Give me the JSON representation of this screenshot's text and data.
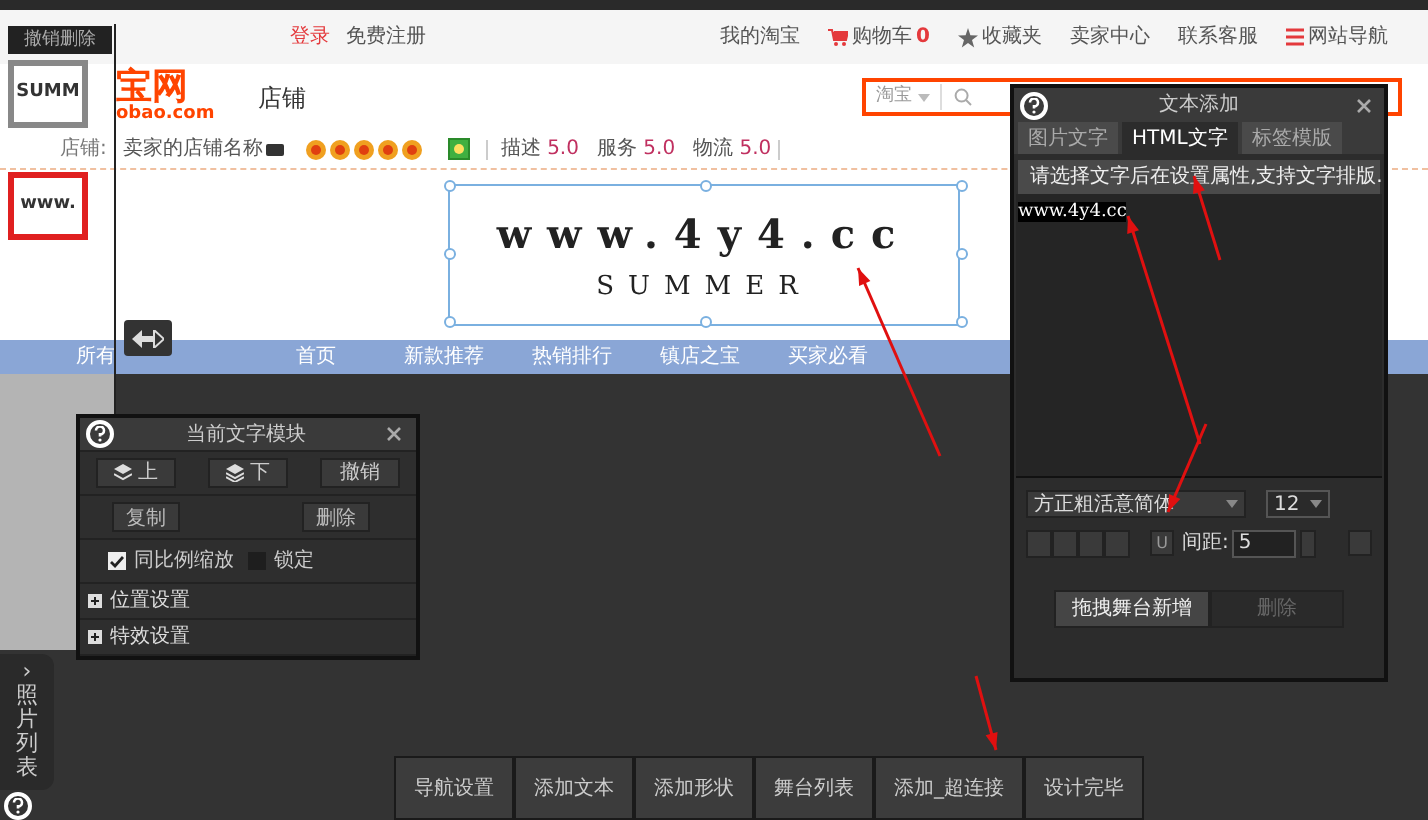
{
  "top_links": {
    "login": "登录",
    "register": "免费注册",
    "right": [
      {
        "label": "我的淘宝",
        "kind": "plain"
      },
      {
        "label": "购物车",
        "kind": "cart",
        "count": "0"
      },
      {
        "label": "收藏夹",
        "kind": "star"
      },
      {
        "label": "卖家中心",
        "kind": "plain"
      },
      {
        "label": "联系客服",
        "kind": "plain"
      },
      {
        "label": "网站导航",
        "kind": "menu"
      }
    ]
  },
  "logo": {
    "main": "宝网",
    "sub": "obao.com"
  },
  "shop_label": "店铺",
  "search": {
    "scope": "淘宝"
  },
  "shop_info": {
    "label": "店铺:",
    "name": "卖家的店铺名称",
    "ratings": [
      {
        "label": "描述",
        "value": "5.0"
      },
      {
        "label": "服务",
        "value": "5.0"
      },
      {
        "label": "物流",
        "value": "5.0"
      }
    ]
  },
  "canvas": {
    "title": "www.4y4.cc",
    "subtitle": "SUMMER"
  },
  "nav": [
    "所有",
    "首页",
    "新款推荐",
    "热销排行",
    "镇店之宝",
    "买家必看"
  ],
  "left_panel": {
    "undo": "撤销删除",
    "thumbnails": [
      {
        "label": "SUMM",
        "selected": false
      },
      {
        "label": "www.",
        "selected": true
      }
    ],
    "photo_tab": "照片列表",
    "expand": "›"
  },
  "module_panel": {
    "title": "当前文字模块",
    "buttons_row1": [
      {
        "label": "上",
        "kind": "up"
      },
      {
        "label": "下",
        "kind": "down"
      },
      {
        "label": "撤销",
        "kind": "plain"
      }
    ],
    "buttons_row2": [
      "复制",
      "删除"
    ],
    "checks": [
      {
        "label": "同比例缩放",
        "checked": true
      },
      {
        "label": "锁定",
        "checked": false
      }
    ],
    "sections": [
      {
        "label": "位置设置",
        "expanded": false
      },
      {
        "label": "特效设置",
        "expanded": false
      }
    ]
  },
  "text_panel": {
    "title": "文本添加",
    "tabs": [
      {
        "label": "图片文字",
        "selected": false
      },
      {
        "label": "HTML文字",
        "selected": true
      },
      {
        "label": "标签模版",
        "selected": false
      }
    ],
    "hint": "请选择文字后在设置属性,支持文字排版.",
    "content": "www.4y4.cc",
    "font": "方正粗活意简体",
    "size": "12",
    "underline": "U",
    "spacing_label": "间距:",
    "spacing": "5",
    "buttons": [
      {
        "label": "拖拽舞台新增",
        "disabled": false
      },
      {
        "label": "删除",
        "disabled": true
      }
    ]
  },
  "toolbar": [
    "导航设置",
    "添加文本",
    "添加形状",
    "舞台列表",
    "添加_超连接",
    "设计完毕"
  ]
}
